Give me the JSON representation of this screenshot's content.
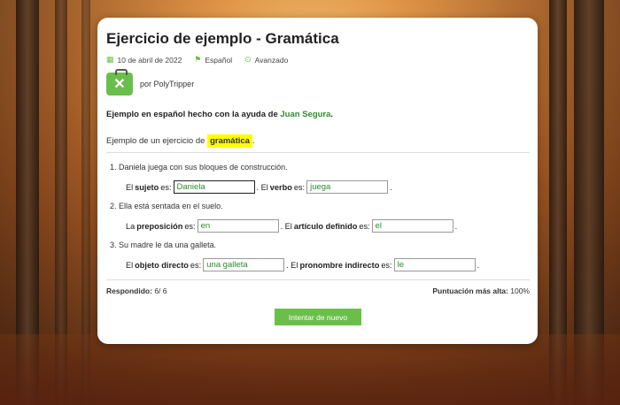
{
  "header": {
    "title": "Ejercicio de ejemplo - Gramática",
    "date": "10 de abril de 2022",
    "language": "Español",
    "level": "Avanzado"
  },
  "author": {
    "by_label": "por PolyTripper"
  },
  "intro": {
    "text": "Ejemplo en español hecho con la ayuda de ",
    "link": "Juan Segura",
    "end": "."
  },
  "example": {
    "prefix": "Ejemplo de un ejercicio de ",
    "highlight": "gramática",
    "suffix": "."
  },
  "questions": [
    {
      "sentence": "Daniela juega con sus bloques de construcción.",
      "p1": "El",
      "b1": "sujeto",
      "p2": "es:",
      "v1": "Daniela",
      "p3": ". El",
      "b2": "verbo",
      "p4": "es:",
      "v2": "juega",
      "end": "."
    },
    {
      "sentence": "Ella está sentada en el suelo.",
      "p1": "La",
      "b1": "preposición",
      "p2": "es:",
      "v1": "en",
      "p3": ". El",
      "b2": "artículo definido",
      "p4": "es:",
      "v2": "el",
      "end": "."
    },
    {
      "sentence": "Su madre le da una galleta.",
      "p1": "El",
      "b1": "objeto directo",
      "p2": "es:",
      "v1": "una galleta",
      "p3": ". El",
      "b2": "pronombre indirecto",
      "p4": "es:",
      "v2": "le",
      "end": "."
    }
  ],
  "footer": {
    "answered_label": "Respondido:",
    "answered_value": "6/ 6",
    "score_label": "Puntuación más alta:",
    "score_value": "100%"
  },
  "retry_label": "Intentar de nuevo",
  "colors": {
    "accent": "#6abf4b",
    "link": "#2e8b2e",
    "highlight": "#ffff00"
  }
}
